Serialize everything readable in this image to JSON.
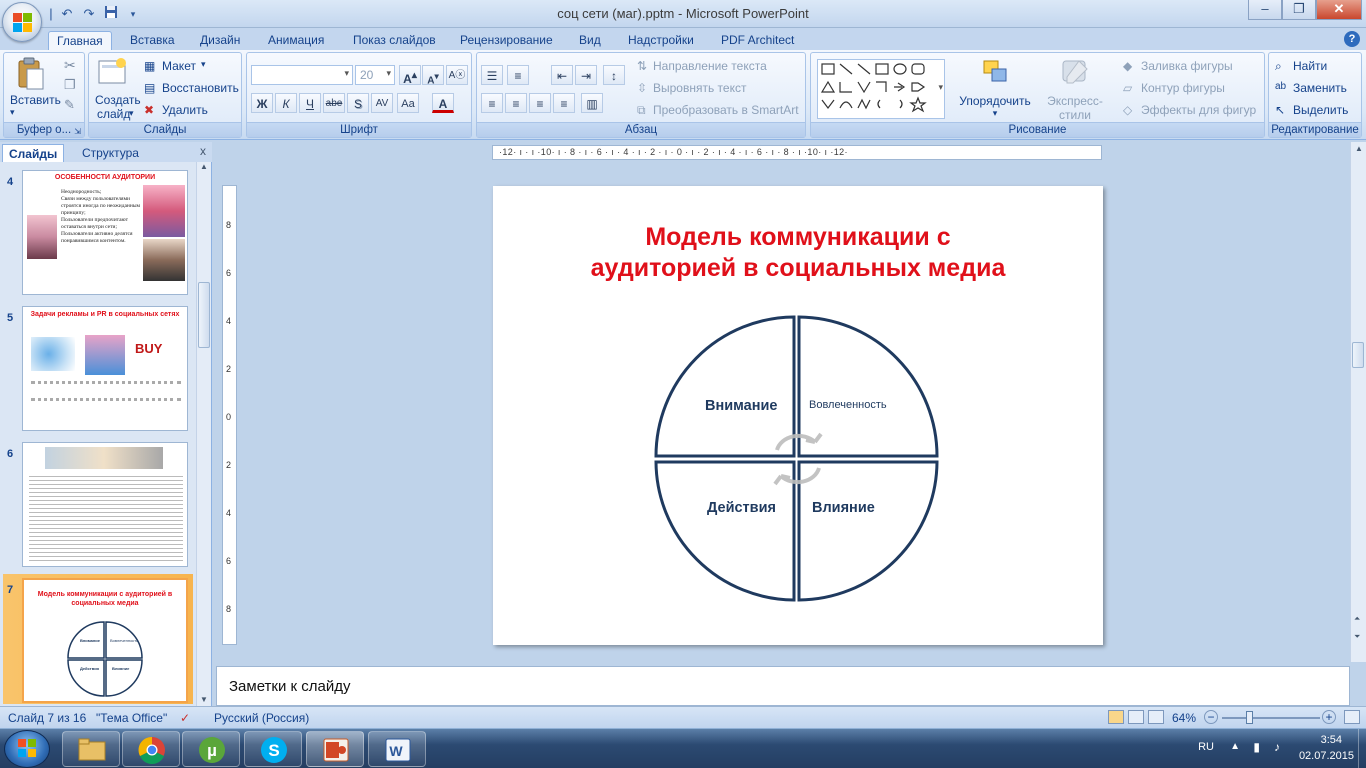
{
  "window": {
    "title": "соц сети (маг).pptm - Microsoft PowerPoint",
    "minimize": "–",
    "restore": "❐",
    "close": "✕"
  },
  "tabs": [
    "Главная",
    "Вставка",
    "Дизайн",
    "Анимация",
    "Показ слайдов",
    "Рецензирование",
    "Вид",
    "Надстройки",
    "PDF Architect"
  ],
  "ribbon": {
    "clipboard": {
      "label": "Буфер о...",
      "paste": "Вставить"
    },
    "slides": {
      "label": "Слайды",
      "new": "Создать",
      "new2": "слайд",
      "layout": "Макет",
      "reset": "Восстановить",
      "delete": "Удалить"
    },
    "font": {
      "label": "Шрифт",
      "size": "20",
      "bold": "Ж",
      "italic": "К",
      "underline": "Ч",
      "strike": "abe",
      "shadow": "S",
      "spacing": "AV",
      "case": "Aa",
      "color": "A"
    },
    "paragraph": {
      "label": "Абзац",
      "text_dir": "Направление текста",
      "align_text": "Выровнять текст",
      "smartart": "Преобразовать в SmartArt"
    },
    "drawing": {
      "label": "Рисование",
      "arrange": "Упорядочить",
      "quick_styles": "Экспресс-стили",
      "fill": "Заливка фигуры",
      "outline": "Контур фигуры",
      "effects": "Эффекты для фигур"
    },
    "editing": {
      "label": "Редактирование",
      "find": "Найти",
      "replace": "Заменить",
      "select": "Выделить"
    }
  },
  "left_panel": {
    "tab_slides": "Слайды",
    "tab_outline": "Структура",
    "close": "x",
    "thumbs": [
      {
        "num": "4",
        "title": "ОСОБЕННОСТИ АУДИТОРИИ",
        "bullets": [
          "Неоднородность;",
          "Связи между пользователями строятся иногда по неожиданным принципу;",
          "Пользователи предпочитают оставаться внутри сети;",
          "Пользователи активно делятся понравившимся контентом."
        ]
      },
      {
        "num": "5",
        "title": "Задачи рекламы и PR в социальных сетях",
        "buy": "BUY"
      },
      {
        "num": "6"
      },
      {
        "num": "7",
        "title": "Модель коммуникации с аудиторией в социальных медиа",
        "q1": "Внимание",
        "q2": "Вовлеченность",
        "q3": "Действия",
        "q4": "Влияние"
      }
    ]
  },
  "slide": {
    "title_line1": "Модель коммуникации с",
    "title_line2": "аудиторией в социальных медиа",
    "quadrants": {
      "top_left": "Внимание",
      "top_right": "Вовлеченность",
      "bottom_left": "Действия",
      "bottom_right": "Влияние"
    }
  },
  "ruler": {
    "h": "·12· ı · ı ·10· ı · 8 · ı · 6 · ı · 4 · ı · 2 · ı · 0 · ı · 2 · ı · 4 · ı · 6 · ı · 8 · ı ·10· ı ·12·",
    "v": [
      "8",
      "6",
      "4",
      "2",
      "0",
      "2",
      "4",
      "6",
      "8"
    ]
  },
  "notes": {
    "placeholder": "Заметки к слайду"
  },
  "status": {
    "slide": "Слайд 7 из 16",
    "theme": "\"Тема Office\"",
    "lang": "Русский (Россия)",
    "zoom": "64%"
  },
  "taskbar": {
    "lang": "RU",
    "time": "3:54",
    "date": "02.07.2015"
  },
  "colors": {
    "title_red": "#e0101a",
    "circle_stroke": "#1f3a5f",
    "quad_text": "#1f3a5f"
  }
}
